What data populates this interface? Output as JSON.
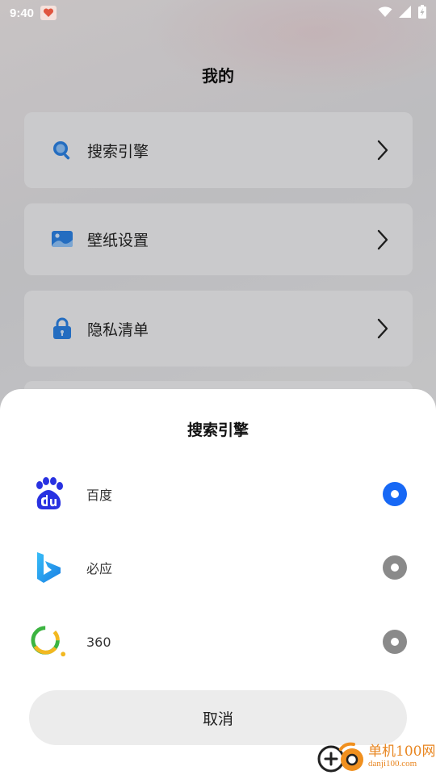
{
  "status_bar": {
    "time": "9:40",
    "icons": [
      "app-notification-icon",
      "wifi-icon",
      "signal-icon",
      "battery-charging-icon"
    ]
  },
  "page": {
    "title": "我的",
    "menu": [
      {
        "label": "搜索引擎",
        "icon": "search-icon"
      },
      {
        "label": "壁纸设置",
        "icon": "wallpaper-icon"
      },
      {
        "label": "隐私清单",
        "icon": "lock-icon"
      }
    ]
  },
  "sheet": {
    "title": "搜索引擎",
    "options": [
      {
        "label": "百度",
        "logo": "baidu-logo-icon",
        "selected": true
      },
      {
        "label": "必应",
        "logo": "bing-logo-icon",
        "selected": false
      },
      {
        "label": "360",
        "logo": "360-logo-icon",
        "selected": false
      }
    ],
    "cancel_label": "取消"
  },
  "watermark": {
    "name": "单机100网",
    "url": "danji100.com"
  },
  "colors": {
    "accent": "#1768f5",
    "radio_off": "#8a8a8a",
    "icon_blue": "#2b7fe0",
    "watermark_orange": "#e8851f"
  }
}
